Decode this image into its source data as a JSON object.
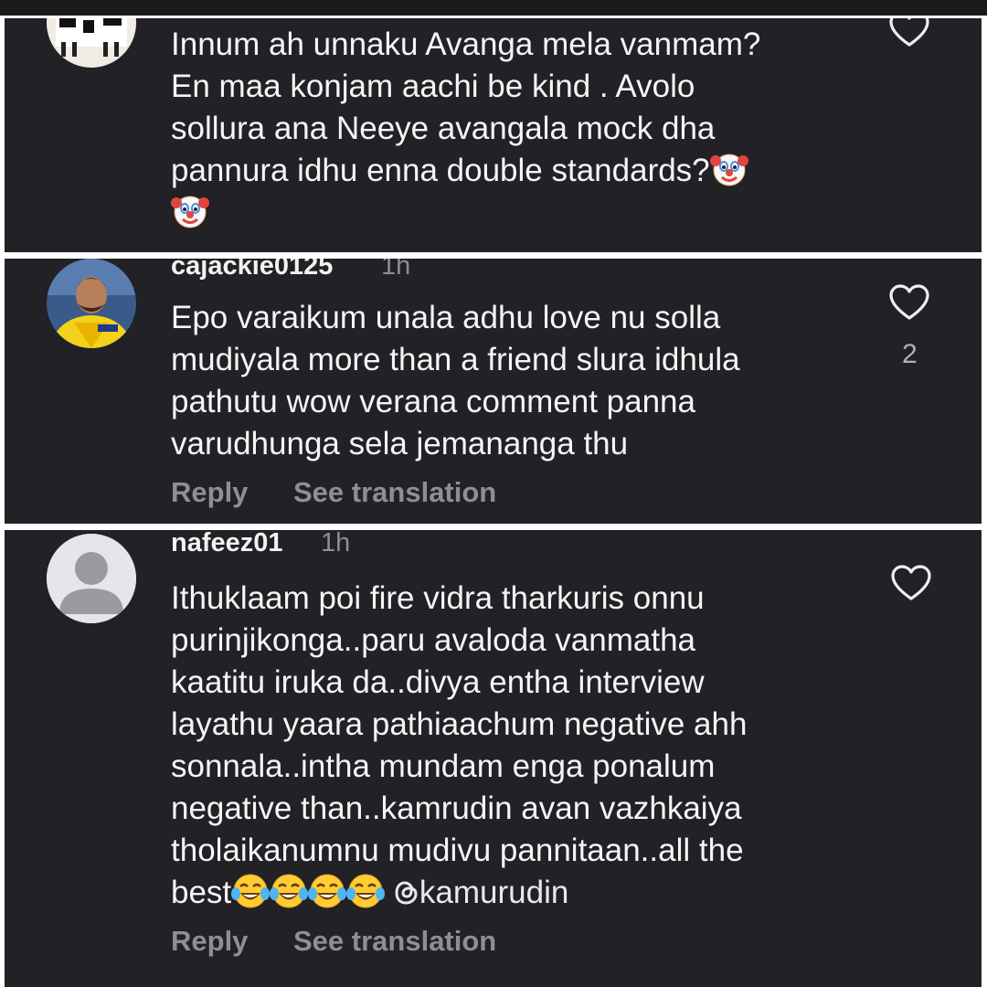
{
  "comments": [
    {
      "username": "",
      "time": "",
      "lines": [
        "Innum ah unnaku Avanga mela vanmam?",
        "En maa konjam aachi  be kind . Avolo",
        "sollura ana Neeye avangala mock dha",
        "pannura idhu enna double standards?"
      ],
      "trailing_emoji": "clown-face",
      "reply_label": "",
      "translation_label": "",
      "likes": ""
    },
    {
      "username": "cajackie0125",
      "time": "1h",
      "lines": [
        "Epo varaikum unala adhu love nu solla",
        "mudiyala more than a friend slura idhula",
        "pathutu wow verana comment panna",
        "varudhunga sela jemananga thu"
      ],
      "reply_label": "Reply",
      "translation_label": "See translation",
      "likes": "2"
    },
    {
      "username": "nafeez01",
      "time": "1h",
      "lines": [
        "Ithuklaam poi fire vidra tharkuris onnu",
        "purinjikonga..paru avaloda vanmatha",
        "kaatitu iruka da..divya entha interview",
        "layathu yaara pathiaachum negative ahh",
        "sonnala..intha mundam enga ponalum",
        "negative than..kamrudin avan vazhkaiya",
        "tholaikanumnu mudivu pannitaan..all the",
        "best"
      ],
      "trailing_emojis": [
        "tears-of-joy",
        "tears-of-joy",
        "tears-of-joy",
        "tears-of-joy"
      ],
      "mention": "kamurudin",
      "mention_icon": "threads-icon",
      "reply_label": "Reply",
      "translation_label": "See translation",
      "likes": ""
    }
  ],
  "colors": {
    "panel_bg": "#212126",
    "primary_text": "#f5f5f5",
    "secondary_text": "#8e8e93",
    "divider": "#ffffff"
  }
}
